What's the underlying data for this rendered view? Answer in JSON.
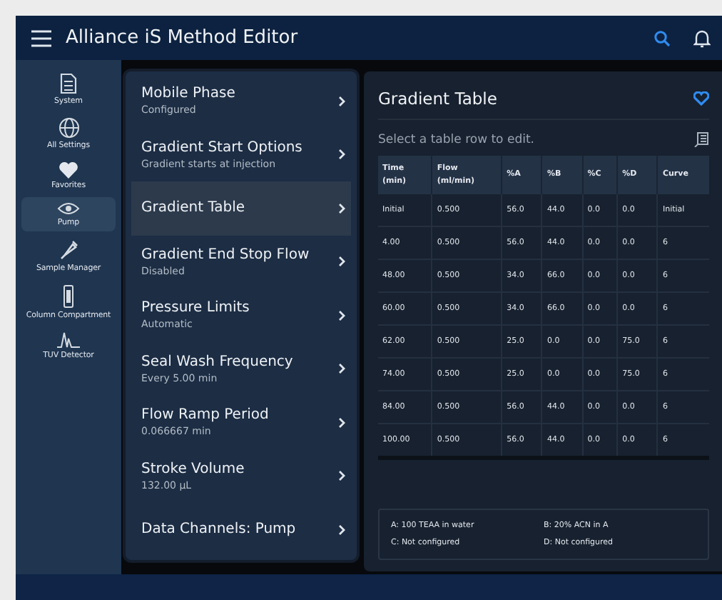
{
  "window": {
    "title": "Alliance iS Method Editor"
  },
  "sidebar": {
    "items": [
      {
        "label": "System",
        "selected": false
      },
      {
        "label": "All Settings",
        "selected": false
      },
      {
        "label": "Favorites",
        "selected": false
      },
      {
        "label": "Pump",
        "selected": true
      },
      {
        "label": "Sample Manager",
        "selected": false
      },
      {
        "label": "Column Compartment",
        "selected": false
      },
      {
        "label": "TUV Detector",
        "selected": false
      }
    ]
  },
  "settings": [
    {
      "title": "Mobile Phase",
      "subtitle": "Configured",
      "selected": false
    },
    {
      "title": "Gradient Start Options",
      "subtitle": "Gradient starts at injection",
      "selected": false
    },
    {
      "title": "Gradient Table",
      "selected": true
    },
    {
      "title": "Gradient End Stop Flow",
      "subtitle": "Disabled",
      "selected": false
    },
    {
      "title": "Pressure Limits",
      "subtitle": "Automatic",
      "selected": false
    },
    {
      "title": "Seal Wash Frequency",
      "subtitle": "Every 5.00 min",
      "selected": false
    },
    {
      "title": "Flow Ramp Period",
      "subtitle": "0.066667 min",
      "selected": false
    },
    {
      "title": "Stroke Volume",
      "subtitle": "132.00  µL",
      "selected": false
    },
    {
      "title": "Data Channels: Pump",
      "selected": false
    }
  ],
  "detail": {
    "title": "Gradient Table",
    "favorite": true,
    "hint": "Select a table row to edit.",
    "table": {
      "columns": [
        "Time (min)",
        "Flow (ml/min)",
        "%A",
        "%B",
        "%C",
        "%D",
        "Curve"
      ],
      "rows": [
        [
          "Initial",
          "0.500",
          "56.0",
          "44.0",
          "0.0",
          "0.0",
          "Initial"
        ],
        [
          "4.00",
          "0.500",
          "56.0",
          "44.0",
          "0.0",
          "0.0",
          "6"
        ],
        [
          "48.00",
          "0.500",
          "34.0",
          "66.0",
          "0.0",
          "0.0",
          "6"
        ],
        [
          "60.00",
          "0.500",
          "34.0",
          "66.0",
          "0.0",
          "0.0",
          "6"
        ],
        [
          "62.00",
          "0.500",
          "25.0",
          "0.0",
          "0.0",
          "75.0",
          "6"
        ],
        [
          "74.00",
          "0.500",
          "25.0",
          "0.0",
          "0.0",
          "75.0",
          "6"
        ],
        [
          "84.00",
          "0.500",
          "56.0",
          "44.0",
          "0.0",
          "0.0",
          "6"
        ],
        [
          "100.00",
          "0.500",
          "56.0",
          "44.0",
          "0.0",
          "0.0",
          "6"
        ]
      ]
    },
    "solvents": [
      "A: 100 TEAA in water",
      "B: 20% ACN in A",
      "C: Not configured",
      "D: Not configured"
    ]
  }
}
